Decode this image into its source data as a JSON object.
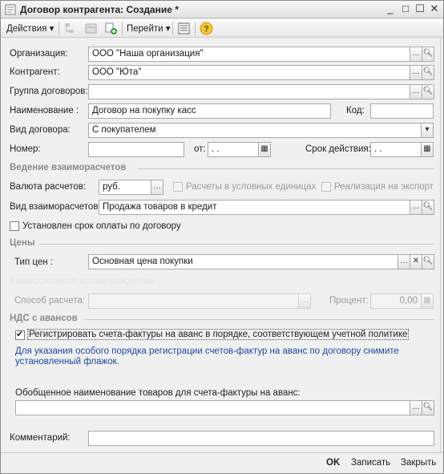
{
  "window": {
    "title": "Договор контрагента: Создание *"
  },
  "toolbar": {
    "actions_label": "Действия",
    "goto_label": "Перейти"
  },
  "form": {
    "organization": {
      "label": "Организация:",
      "value": "ООО \"Наша организация\""
    },
    "counterparty": {
      "label": "Контрагент:",
      "value": "ООО \"Юта\""
    },
    "contract_group": {
      "label": "Группа договоров:",
      "value": ""
    },
    "name": {
      "label": "Наименование :",
      "value": "Договор на покупку касс"
    },
    "code": {
      "label": "Код:",
      "value": ""
    },
    "contract_type": {
      "label": "Вид договора:",
      "value": "С покупателем"
    },
    "number": {
      "label": "Номер:",
      "value": ""
    },
    "date_from": {
      "label": "от:",
      "value": " .  ."
    },
    "validity": {
      "label": "Срок действия:",
      "value": " .  ."
    }
  },
  "settlements": {
    "section_title": "Ведение взаиморасчетов",
    "currency": {
      "label": "Валюта расчетов:",
      "value": "руб."
    },
    "conventional_units_label": "Расчеты в условных единицах",
    "export_label": "Реализация на экспорт",
    "settlement_type": {
      "label": "Вид взаиморасчетов:",
      "value": "Продажа товаров в кредит"
    },
    "payment_term_label": "Установлен срок оплаты по договору"
  },
  "prices": {
    "section_title": "Цены",
    "price_type": {
      "label": "Тип цен :",
      "value": "Основная цена покупки"
    }
  },
  "commission": {
    "section_title": "Комиссионное вознаграждение",
    "method": {
      "label": "Способ расчета:",
      "value": ""
    },
    "percent": {
      "label": "Процент:",
      "value": "0,00"
    }
  },
  "vat": {
    "section_title": "НДС с авансов",
    "register_label": "Регистрировать счета-фактуры на аванс в порядке, соответствующем учетной политике",
    "register_checked": true,
    "note_line1": "Для указания особого порядка регистрации счетов-фактур на аванс по договору снимите",
    "note_line2": "установленный флажок.",
    "generic_name_label": "Обобщенное наименование товаров для счета-фактуры на аванс:",
    "generic_name_value": ""
  },
  "comment": {
    "label": "Комментарий:",
    "value": ""
  },
  "buttons": {
    "ok": "OK",
    "save": "Записать",
    "close": "Закрыть"
  },
  "colors": {
    "note_blue": "#1b4aa0",
    "section_gray": "#8b8b8b"
  }
}
